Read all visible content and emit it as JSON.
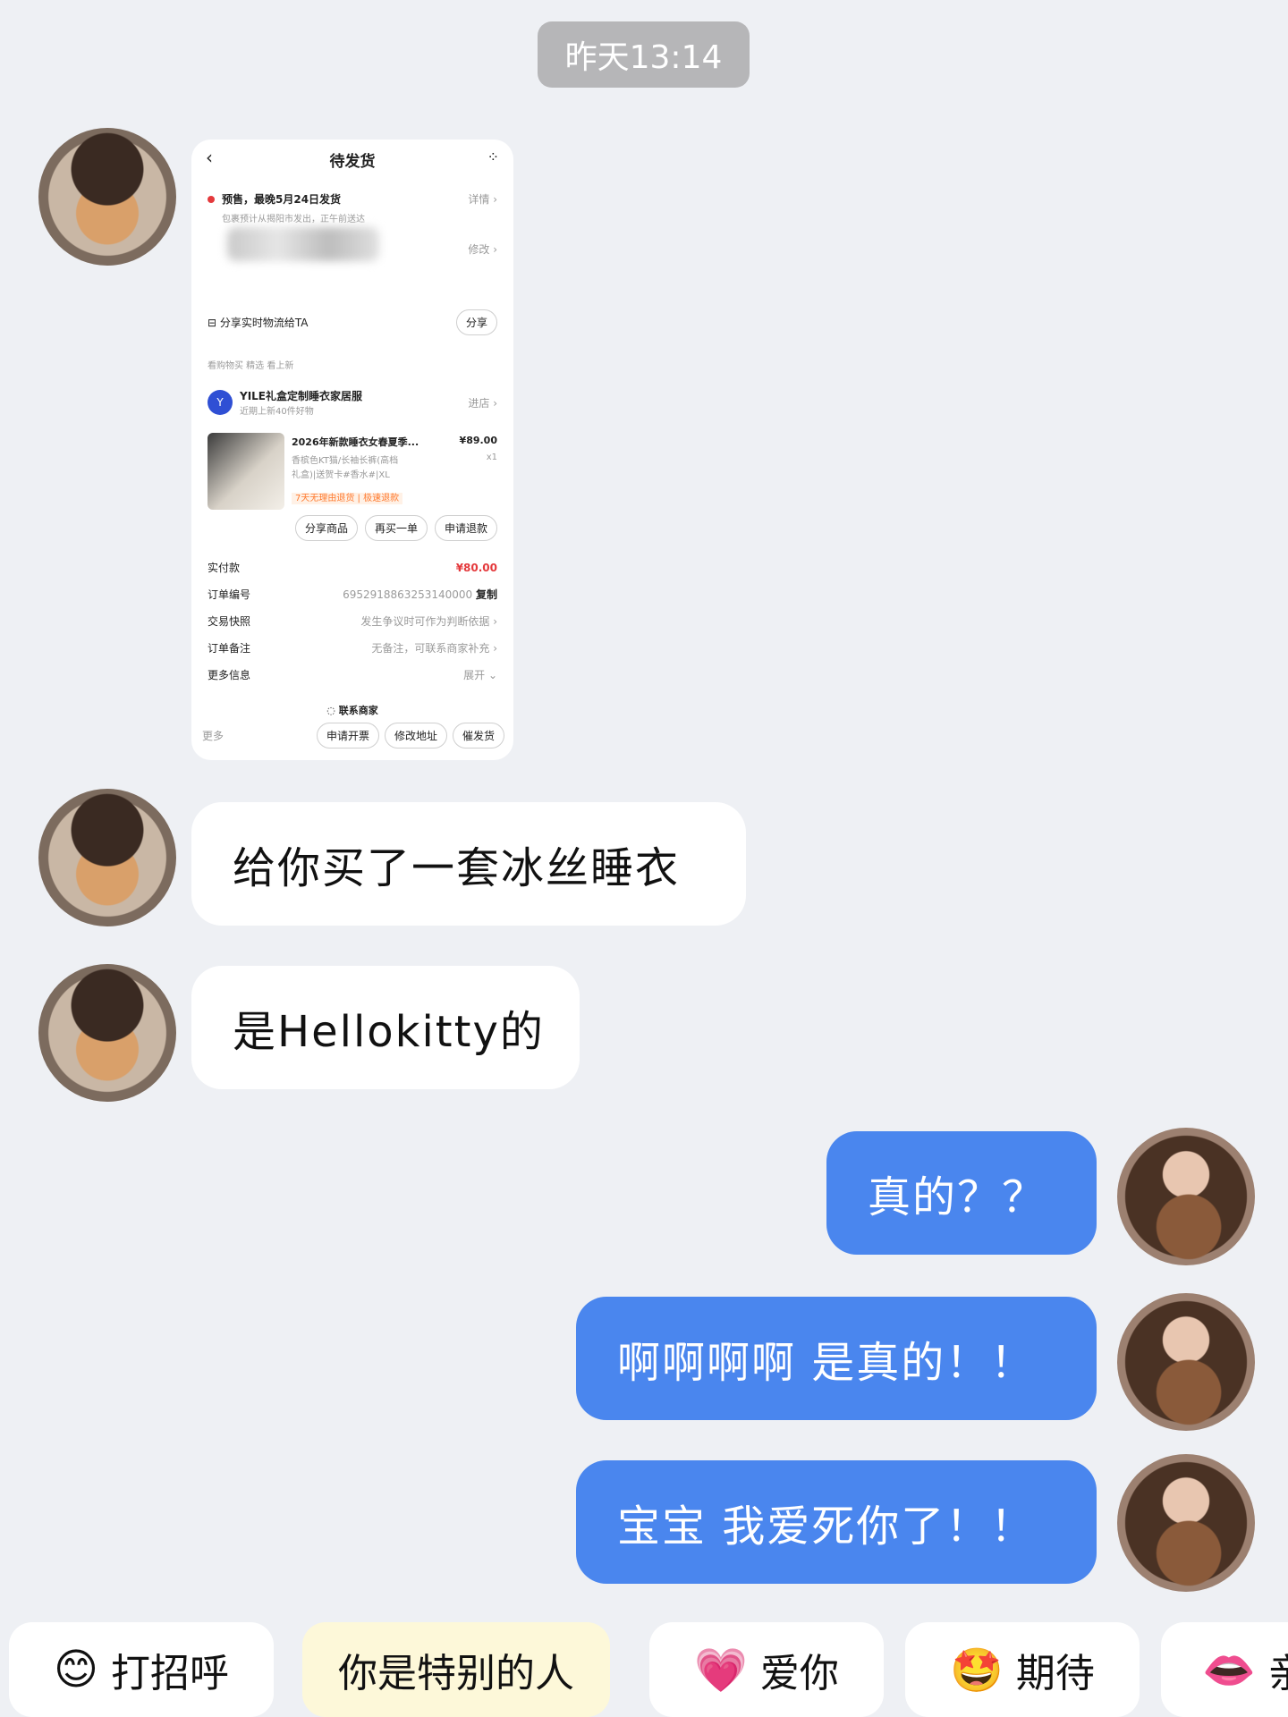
{
  "chat": {
    "timestamp": "昨天13:14",
    "messages": [
      {
        "side": "left",
        "type": "image"
      },
      {
        "side": "left",
        "text": "给你买了一套冰丝睡衣"
      },
      {
        "side": "left",
        "text": "是Hellokitty的"
      },
      {
        "side": "right",
        "text": "真的？？"
      },
      {
        "side": "right",
        "text": "啊啊啊啊 是真的！！"
      },
      {
        "side": "right",
        "text": "宝宝 我爱死你了！！"
      }
    ]
  },
  "order_screenshot": {
    "header_title": "待发货",
    "presale_text": "预售，最晚5月24日发货",
    "presale_detail": "详情",
    "presale_sub": "包裹预计从揭阳市发出，正午前送达",
    "modify": "修改",
    "share_logistics": "分享实时物流给TA",
    "share_btn": "分享",
    "fav_shop": "看购物买 精选  看上新",
    "shop_name": "YILE礼盒定制睡衣家居服",
    "shop_sub": "近期上新40件好物",
    "enter_shop": "进店",
    "product_title": "2026年新款睡衣女春夏季...",
    "product_price": "¥89.00",
    "product_desc_1": "香槟色KT猫/长袖长裤(高档",
    "product_desc_2": "礼盒)|送贺卡#香水#|XL",
    "product_qty": "x1",
    "product_tag": "7天无理由退货 | 极速退款",
    "btn_share_product": "分享商品",
    "btn_buy_again": "再买一单",
    "btn_refund": "申请退款",
    "paid_label": "实付款",
    "paid_value": "¥80.00",
    "order_no_label": "订单编号",
    "order_no_value": "6952918863253140000",
    "copy": "复制",
    "snapshot_label": "交易快照",
    "snapshot_value": "发生争议时可作为判断依据",
    "remark_label": "订单备注",
    "remark_value": "无备注，可联系商家补充",
    "more_info_label": "更多信息",
    "more_info_value": "展开",
    "contact_seller": "联系商家",
    "more": "更多",
    "btn_invoice": "申请开票",
    "btn_modify_address": "修改地址",
    "btn_urge": "催发货"
  },
  "quick_replies": [
    {
      "emoji": "😊",
      "label": "打招呼"
    },
    {
      "emoji": "",
      "label": "你是特别的人"
    },
    {
      "emoji": "💗",
      "label": "爱你"
    },
    {
      "emoji": "🤩",
      "label": "期待"
    },
    {
      "emoji": "👄",
      "label": "亲"
    }
  ],
  "colors": {
    "background": "#eef0f4",
    "right_bubble": "#4a86ee",
    "left_bubble": "#ffffff",
    "timestamp_bg": "#b6b6b8",
    "price_red": "#e4393c"
  }
}
